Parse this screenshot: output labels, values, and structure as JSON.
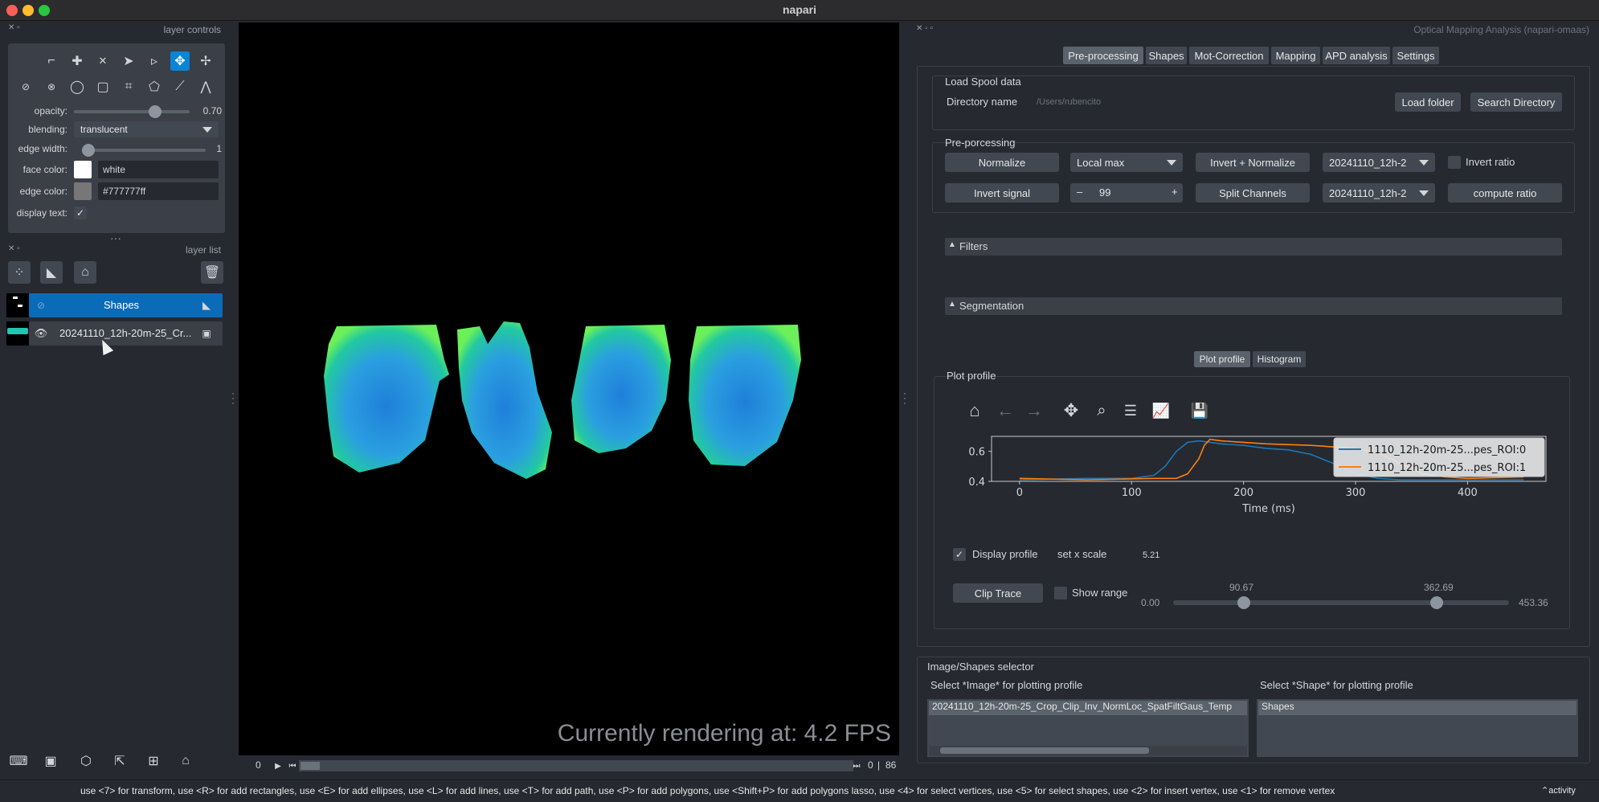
{
  "window": {
    "title": "napari"
  },
  "left": {
    "layer_controls_title": "layer controls",
    "opacity_label": "opacity:",
    "opacity_value": "0.70",
    "opacity_fraction": 0.7,
    "blending_label": "blending:",
    "blending_value": "translucent",
    "edge_width_label": "edge width:",
    "edge_width_value": "1",
    "face_color_label": "face color:",
    "face_color_value": "white",
    "edge_color_label": "edge color:",
    "edge_color_value": "#777777ff",
    "display_text_label": "display text:",
    "layer_list_title": "layer list",
    "layers": [
      {
        "name": "Shapes",
        "selected": true
      },
      {
        "name": "20241110_12h-20m-25_Cr...",
        "selected": false
      }
    ]
  },
  "canvas": {
    "fps_text": "Currently rendering at: 4.2 FPS",
    "slider_start": "0",
    "slider_pos": "0",
    "slider_end": "86"
  },
  "right": {
    "title": "Optical Mapping Analysis (napari-omaas)",
    "tabs": [
      "Pre-processing",
      "Shapes",
      "Mot-Correction",
      "Mapping",
      "APD analysis",
      "Settings"
    ],
    "load_spool": {
      "title": "Load Spool data",
      "dir_label": "Directory name",
      "dir_placeholder": "/Users/rubencito",
      "load_folder": "Load folder",
      "search_dir": "Search Directory"
    },
    "preproc": {
      "title": "Pre-porcessing",
      "normalize": "Normalize",
      "local_max": "Local max",
      "invert_normalize": "Invert + Normalize",
      "combo1": "20241110_12h-2",
      "invert_ratio": "Invert ratio",
      "invert_signal": "Invert signal",
      "spin_minus": "–",
      "spin_value": "99",
      "spin_plus": "+",
      "split_channels": "Split Channels",
      "combo2": "20241110_12h-2",
      "compute_ratio": "compute ratio"
    },
    "filters": "Filters",
    "segmentation": "Segmentation",
    "plot_tabs": [
      "Plot profile",
      "Histogram"
    ],
    "plot_profile_title": "Plot profile",
    "display_profile": "Display profile",
    "set_x_scale": "set x scale",
    "x_scale_value": "5.21",
    "clip_trace": "Clip Trace",
    "show_range": "Show range",
    "range_min": "0.00",
    "range_low": "90.67",
    "range_high": "362.69",
    "range_max": "453.36",
    "selector": {
      "title": "Image/Shapes selector",
      "image_label": "Select *Image* for plotting profile",
      "image_item": "20241110_12h-20m-25_Crop_Clip_Inv_NormLoc_SpatFiltGaus_Temp",
      "shape_label": "Select *Shape* for plotting profile",
      "shape_item": "Shapes"
    }
  },
  "status": {
    "text": "use <7> for transform, use <R> for add rectangles, use <E> for add ellipses, use <L> for add lines, use <T> for add path, use <P> for add polygons, use <Shift+P> for add polygons lasso, use <4> for select vertices, use <5> for select shapes, use <2> for insert vertex, use <1> for remove vertex",
    "activity": "activity"
  },
  "chart_data": {
    "type": "line",
    "xlabel": "Time (ms)",
    "ylabel": "",
    "xlim": [
      -25,
      470
    ],
    "ylim": [
      0.4,
      0.7
    ],
    "xticks": [
      "0",
      "100",
      "200",
      "300",
      "400"
    ],
    "yticks": [
      "0.4",
      "0.6"
    ],
    "legend_position": "top-right",
    "series": [
      {
        "name": "1110_12h-20m-25...pes_ROI:0",
        "color": "#1f77b4",
        "x": [
          0,
          60,
          100,
          120,
          130,
          140,
          150,
          160,
          170,
          180,
          200,
          220,
          240,
          260,
          280,
          300,
          320,
          340,
          360,
          400,
          450
        ],
        "y": [
          0.41,
          0.42,
          0.42,
          0.44,
          0.5,
          0.6,
          0.66,
          0.67,
          0.66,
          0.65,
          0.64,
          0.62,
          0.61,
          0.58,
          0.52,
          0.45,
          0.42,
          0.41,
          0.41,
          0.41,
          0.41
        ]
      },
      {
        "name": "1110_12h-20m-25...pes_ROI:1",
        "color": "#ff7f0e",
        "x": [
          0,
          60,
          120,
          140,
          150,
          160,
          165,
          170,
          180,
          200,
          220,
          260,
          300,
          320,
          340,
          360,
          380,
          400,
          450
        ],
        "y": [
          0.42,
          0.41,
          0.42,
          0.42,
          0.45,
          0.55,
          0.64,
          0.68,
          0.67,
          0.66,
          0.65,
          0.64,
          0.62,
          0.59,
          0.52,
          0.45,
          0.43,
          0.42,
          0.43
        ]
      }
    ]
  }
}
